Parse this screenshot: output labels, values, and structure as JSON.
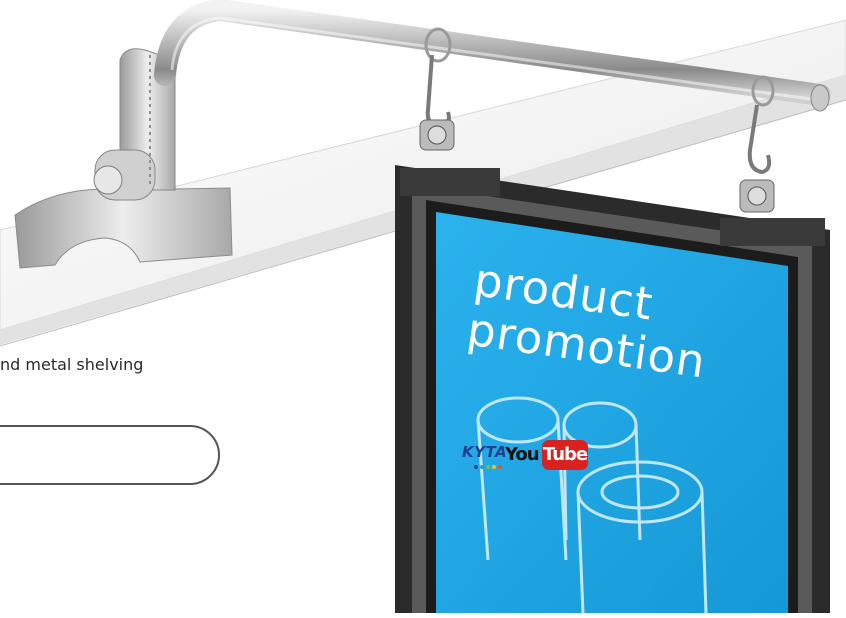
{
  "caption": "nd metal shelving",
  "sign": {
    "line1": "product",
    "line2": "promotion"
  },
  "logos": {
    "kyta": "KYTA",
    "youtube_you": "You",
    "youtube_tube": "Tube"
  },
  "colors": {
    "sign_blue": "#1ea7e6",
    "frame": "#2b2b2b",
    "youtube_red": "#d9221f",
    "kyta_blue": "#1f3f8f"
  }
}
